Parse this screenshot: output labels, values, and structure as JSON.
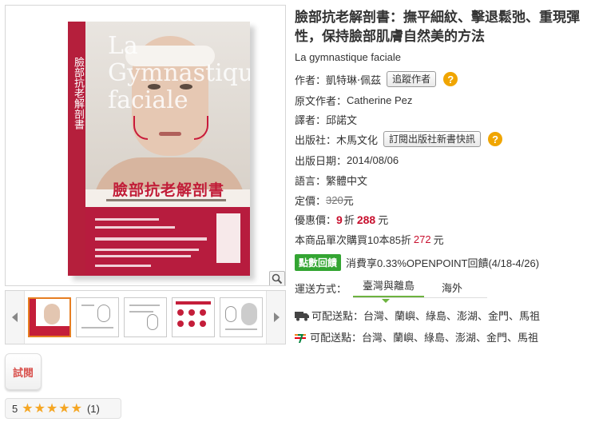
{
  "cover": {
    "spine_text": "臉部抗老解剖書",
    "latin_text": "La Gymnastique faciale",
    "chinese_title": "臉部抗老解剖書"
  },
  "thumbnails": [
    "cover",
    "page-2",
    "page-3",
    "page-4",
    "page-5"
  ],
  "trial_button": "試閱",
  "rating": {
    "score": "5",
    "stars": "★★★★★",
    "count": "(1)"
  },
  "book": {
    "title": "臉部抗老解剖書：撫平細紋、擊退鬆弛、重現彈性，保持臉部肌膚自然美的方法",
    "original_title": "La gymnastique faciale",
    "author_label": "作者：",
    "author": "凱特琳‧佩茲",
    "follow_author_button": "追蹤作者",
    "original_author_label": "原文作者：",
    "original_author": "Catherine Pez",
    "translator_label": "譯者：",
    "translator": "邱諾文",
    "publisher_label": "出版社：",
    "publisher": "木馬文化",
    "subscribe_publisher_button": "訂閱出版社新書快訊",
    "pub_date_label": "出版日期：",
    "pub_date": "2014/08/06",
    "language_label": "語言：",
    "language": "繁體中文",
    "list_price_label": "定價：",
    "list_price": "320",
    "list_price_unit": "元",
    "sale_label": "優惠價：",
    "discount": "9",
    "discount_unit": "折",
    "sale_price": "288",
    "sale_unit": "元",
    "bulk_text_prefix": "本商品單次購買10本85折",
    "bulk_price": "272",
    "bulk_unit": "元",
    "points_badge": "點數回饋",
    "points_text": "消費享0.33%OPENPOINT回饋(4/18-4/26)",
    "shipping_label": "運送方式：",
    "shipping_tabs": [
      "臺灣與離島",
      "海外"
    ],
    "home_delivery_text": "可配送點：台灣、蘭嶼、綠島、澎湖、金門、馬祖",
    "store_pickup_text": "可配送點：台灣、蘭嶼、綠島、澎湖、金門、馬祖"
  },
  "colors": {
    "accent_green": "#6db33f",
    "price_red": "#c8102e",
    "help_orange": "#f0a500",
    "badge_green": "#33a532"
  }
}
